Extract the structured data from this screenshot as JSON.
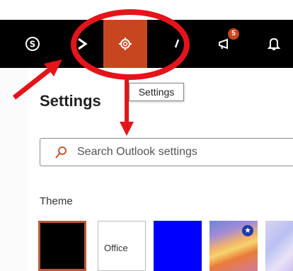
{
  "topbar": {
    "badge_count": "5"
  },
  "tooltip": {
    "text": "Settings"
  },
  "settings": {
    "title": "Settings",
    "search_placeholder": "Search Outlook settings",
    "theme_label": "Theme",
    "themes": [
      {
        "name": "black"
      },
      {
        "name": "Office"
      },
      {
        "name": "blue"
      },
      {
        "name": "beach"
      },
      {
        "name": "pastel"
      }
    ]
  },
  "colors": {
    "accent": "#c8461f",
    "annotation": "#e3151a",
    "topbar_bg": "#000000"
  },
  "icons": [
    "skype-icon",
    "forward-arrow-icon",
    "gear-icon",
    "megaphone-icon",
    "bell-icon",
    "search-icon",
    "star-icon"
  ]
}
